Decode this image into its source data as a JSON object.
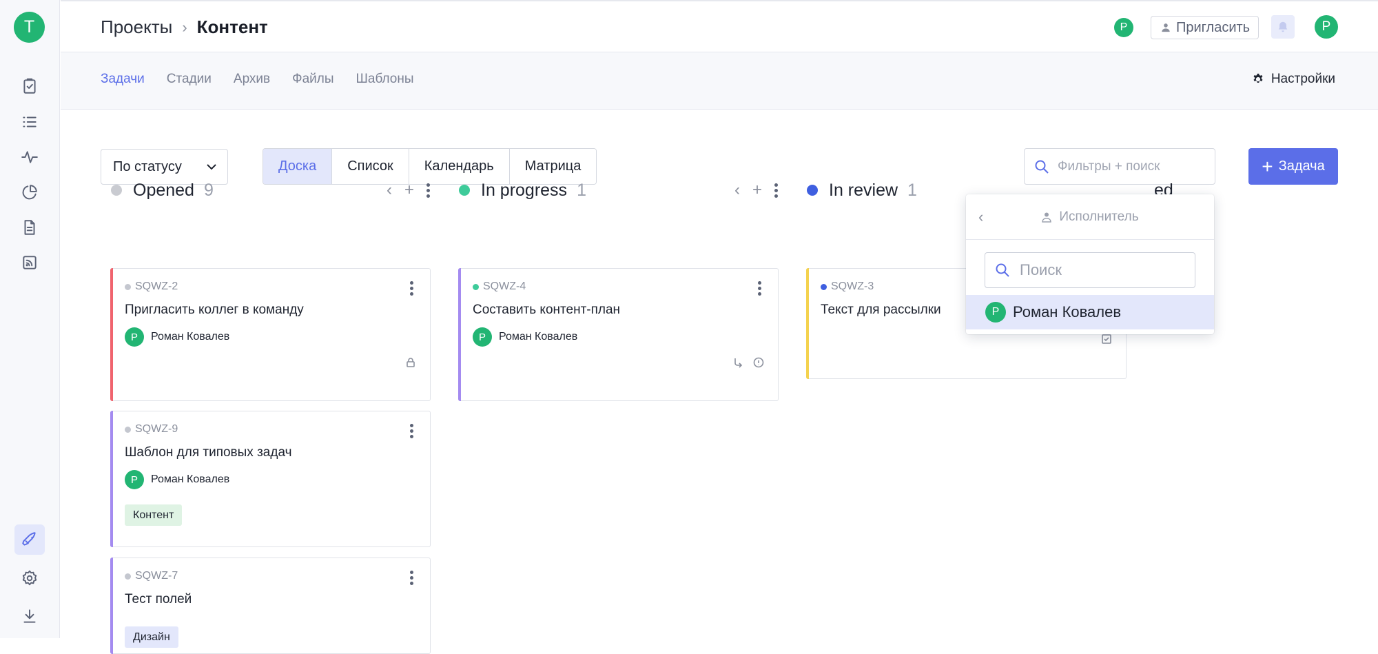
{
  "workspace": {
    "avatar_letter": "T"
  },
  "breadcrumb": {
    "parent": "Проекты",
    "separator": "›",
    "current": "Контент"
  },
  "topbar": {
    "member_avatar": "Р",
    "invite_label": "Пригласить",
    "user_avatar": "Р"
  },
  "subnav": {
    "tabs": [
      {
        "label": "Задачи",
        "active": true
      },
      {
        "label": "Стадии",
        "active": false
      },
      {
        "label": "Архив",
        "active": false
      },
      {
        "label": "Файлы",
        "active": false
      },
      {
        "label": "Шаблоны",
        "active": false
      }
    ],
    "settings_label": "Настройки"
  },
  "toolbar": {
    "group_by": "По статусу",
    "views": [
      {
        "label": "Доска",
        "active": true
      },
      {
        "label": "Список",
        "active": false
      },
      {
        "label": "Календарь",
        "active": false
      },
      {
        "label": "Матрица",
        "active": false
      }
    ],
    "search_placeholder": "Фильтры + поиск",
    "add_task_label": "Задача",
    "add_task_plus": "+"
  },
  "columns": [
    {
      "title": "Opened",
      "count": "9",
      "dot_color": "#c9cbd1",
      "cards": [
        {
          "key": "SQWZ-2",
          "title": "Пригласить коллег в команду",
          "assignee": "Роман Ковалев",
          "assignee_initial": "Р",
          "bar_color": "#f0646e"
        },
        {
          "key": "SQWZ-9",
          "title": "Шаблон для типовых задач",
          "assignee": "Роман Ковалев",
          "assignee_initial": "Р",
          "tag": "Контент",
          "bar_color": "#a48bf0"
        },
        {
          "key": "SQWZ-7",
          "title": "Тест полей",
          "tag": "Дизайн",
          "bar_color": "#a48bf0"
        }
      ]
    },
    {
      "title": "In progress",
      "count": "1",
      "dot_color": "#3ecb9a",
      "cards": [
        {
          "key": "SQWZ-4",
          "title": "Составить контент-план",
          "assignee": "Роман Ковалев",
          "assignee_initial": "Р",
          "bar_color": "#a48bf0",
          "key_dot_color": "#3ecb9a"
        }
      ]
    },
    {
      "title": "In review",
      "count": "1",
      "dot_color": "#3f5fe0",
      "cards": [
        {
          "key": "SQWZ-3",
          "title": "Текст для рассылки",
          "bar_color": "#f4d24e",
          "key_dot_color": "#3f5fe0"
        }
      ]
    },
    {
      "title_visible_part": "ed"
    }
  ],
  "assignee_dropdown": {
    "back": "‹",
    "title": "Исполнитель",
    "search_placeholder": "Поиск",
    "options": [
      {
        "name": "Роман Ковалев",
        "initial": "Р"
      }
    ]
  }
}
